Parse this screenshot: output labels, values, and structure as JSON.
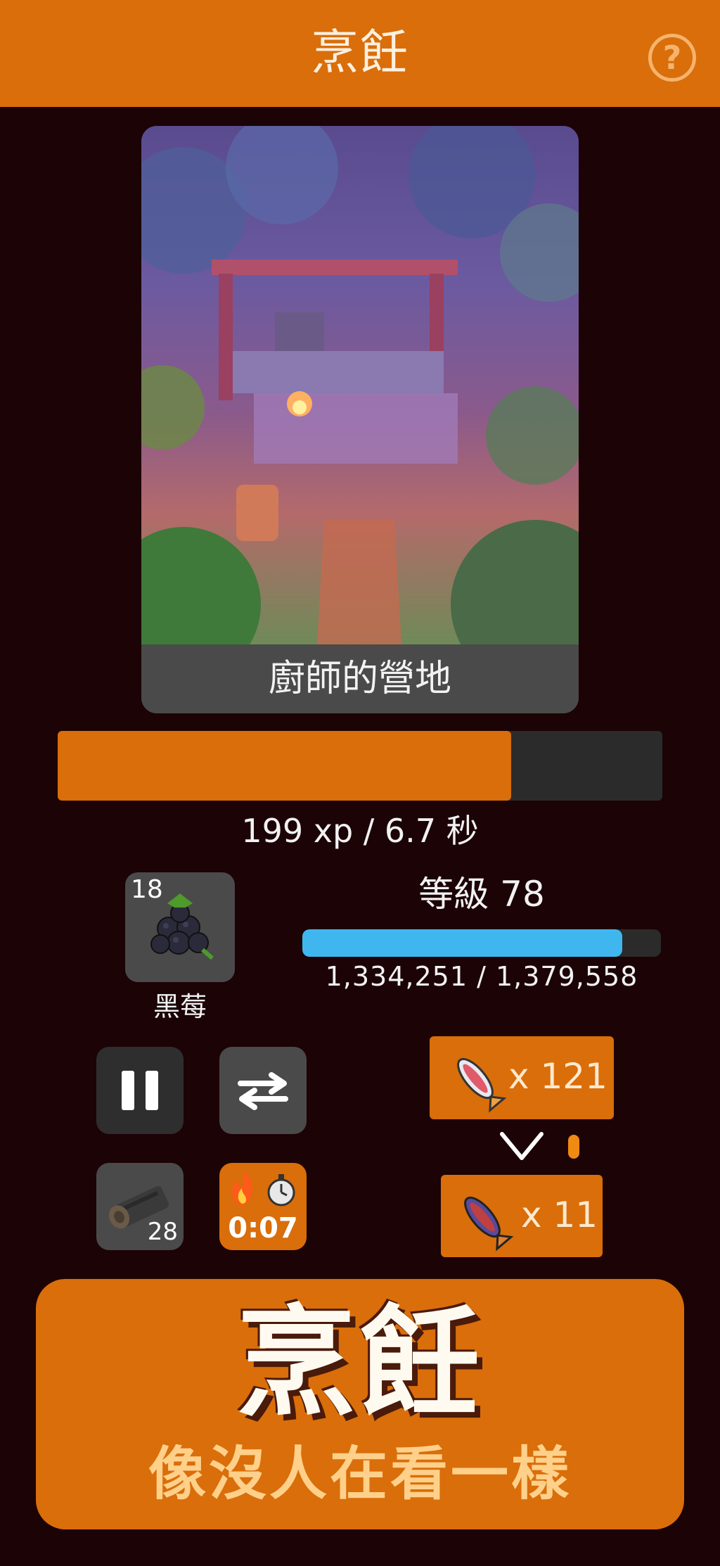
{
  "header": {
    "title": "烹飪",
    "help_label": "?"
  },
  "scene": {
    "caption": "廚師的營地"
  },
  "action": {
    "progress": 0.75,
    "xp_text": "199 xp / 6.7 秒"
  },
  "item": {
    "count": "18",
    "name": "黑莓",
    "icon": "blackberry-icon"
  },
  "level": {
    "label": "等級 78",
    "progress": 0.893,
    "progress_text": "1,334,251 / 1,379,558"
  },
  "controls": {
    "pause_icon": "pause-icon",
    "swap_icon": "swap-arrows-icon",
    "log_count": "28",
    "timer": "0:07"
  },
  "products": {
    "input_count": "x 121",
    "output_count": "x 11"
  },
  "banner": {
    "title": "烹飪",
    "subtitle": "像沒人在看一樣"
  },
  "colors": {
    "accent": "#d96e0a",
    "background": "#1c0306",
    "level_bar": "#3fb7ee"
  }
}
